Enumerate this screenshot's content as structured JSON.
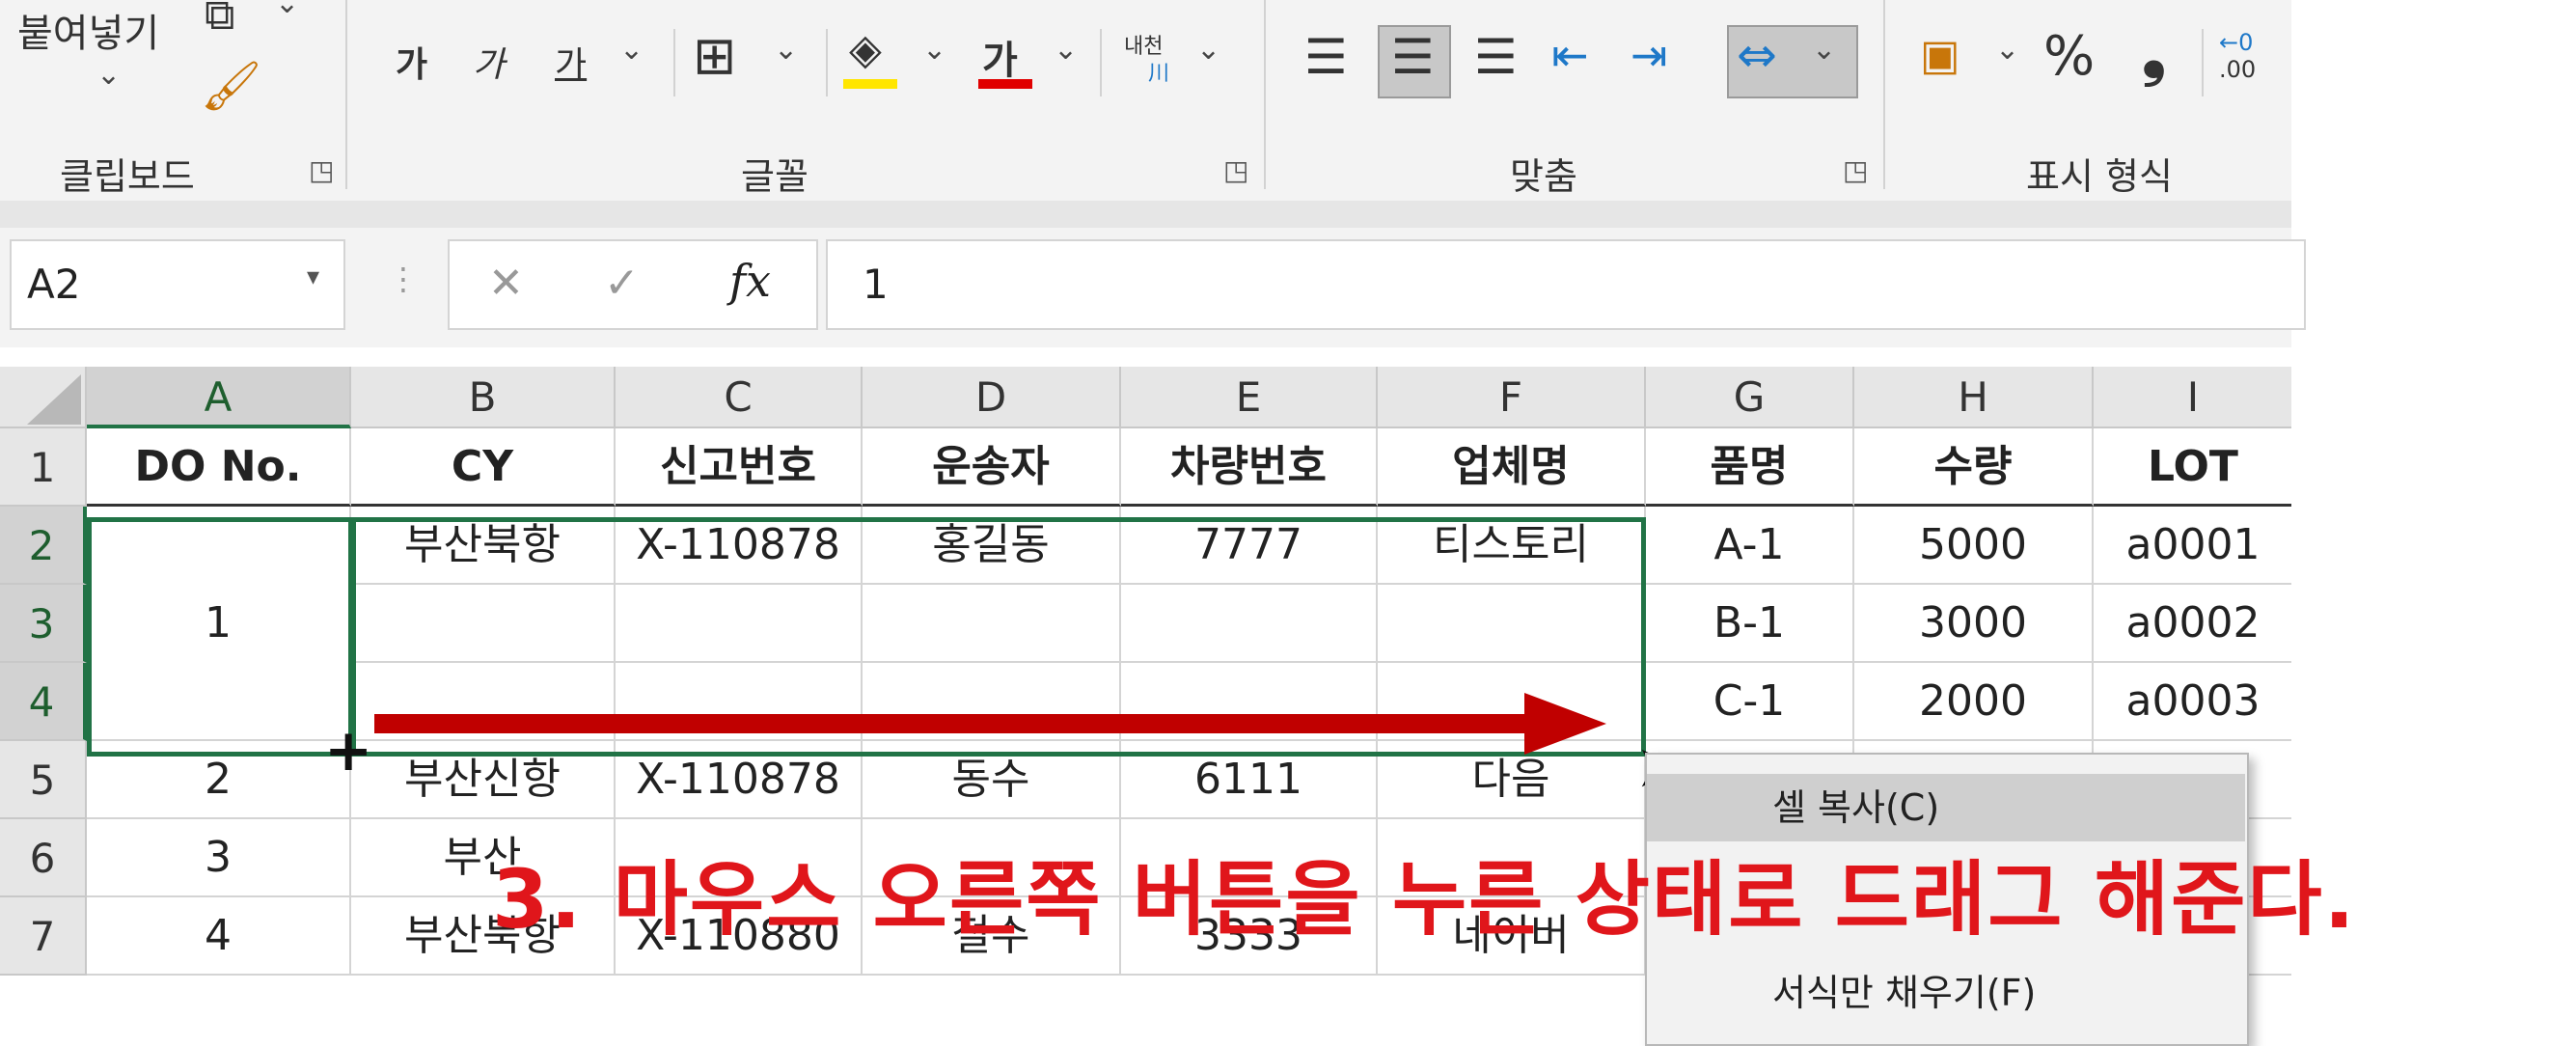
{
  "ribbon": {
    "clipboard": {
      "paste_label": "붙여넣기",
      "group_label": "클립보드"
    },
    "font": {
      "bold": "가",
      "italic": "가",
      "underline": "가",
      "font_color_glyph": "가",
      "phonetic_top": "내천",
      "phonetic_bottom": "川",
      "group_label": "글꼴"
    },
    "alignment": {
      "group_label": "맞춤"
    },
    "number": {
      "percent": "%",
      "comma": "❟",
      "decimal_top": "←0",
      "decimal_bottom": ".00",
      "group_label": "표시 형식"
    }
  },
  "formula_bar": {
    "name_box": "A2",
    "fx": "fx",
    "value": "1",
    "cancel_icon": "✕",
    "enter_icon": "✓"
  },
  "sheet": {
    "columns": [
      "A",
      "B",
      "C",
      "D",
      "E",
      "F",
      "G",
      "H",
      "I"
    ],
    "active_column": "A",
    "rows": [
      "1",
      "2",
      "3",
      "4",
      "5",
      "6",
      "7"
    ],
    "header_row": [
      "DO No.",
      "CY",
      "신고번호",
      "운송자",
      "차량번호",
      "업체명",
      "품명",
      "수량",
      "LOT"
    ],
    "data": [
      {
        "a": "1",
        "b": "부산북항",
        "c": "X-110878",
        "d": "홍길동",
        "e": "7777",
        "f": "티스토리",
        "g": "A-1",
        "h": "5000",
        "i": "a0001"
      },
      {
        "g": "B-1",
        "h": "3000",
        "i": "a0002"
      },
      {
        "g": "C-1",
        "h": "2000",
        "i": "a0003"
      },
      {
        "a": "2",
        "b": "부산신항",
        "c": "X-110878",
        "d": "동수",
        "e": "6111",
        "f": "다음"
      },
      {
        "a": "3",
        "b": "부산"
      },
      {
        "a": "4",
        "b": "부산북항",
        "c": "X-110880",
        "d": "철수",
        "e": "3333",
        "f": "네이버"
      }
    ]
  },
  "context_menu": {
    "items": [
      "셀 복사(C)",
      "서식만 채우기(F)"
    ]
  },
  "caption": "3. 마우스 오른쪽 버튼을 누른 상태로 드래그 해준다.",
  "colors": {
    "accent": "#217346",
    "arrow": "#c00000",
    "caption": "#e0161b"
  }
}
